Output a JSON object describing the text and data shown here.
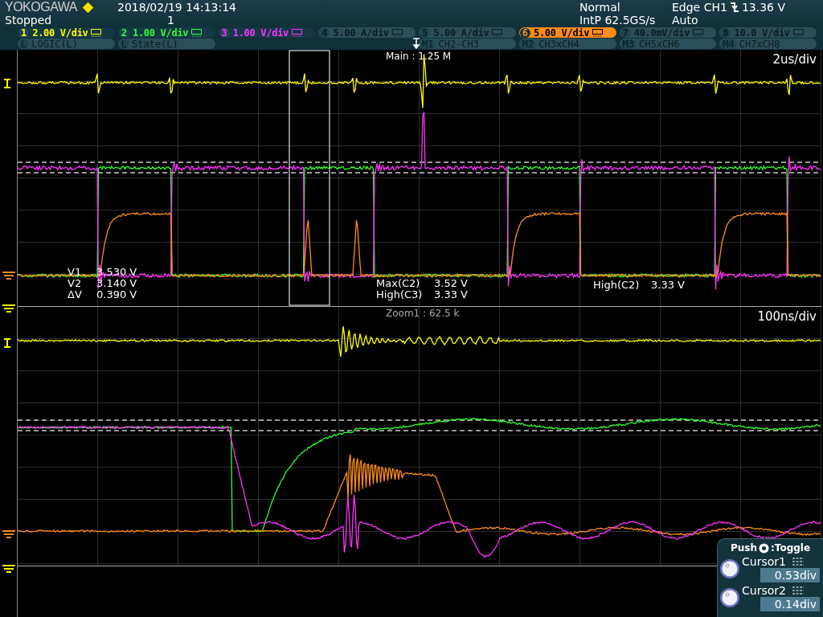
{
  "header": {
    "brand": "YOKOGAWA",
    "datetime": "2018/02/19 14:13:14",
    "state": "Stopped",
    "acq_count": "1",
    "mode": "Normal",
    "sample_rate": "IntP 62.5GS/s",
    "trigger_type": "Edge CH1",
    "trigger_level": "13.36 V",
    "trigger_mode": "Auto"
  },
  "channels": [
    {
      "number": "1",
      "scale": "2.00 V/div",
      "color": "#ffff00",
      "enabled": true,
      "selected": false
    },
    {
      "number": "2",
      "scale": "1.00 V/div",
      "color": "#33ff33",
      "enabled": true,
      "selected": false
    },
    {
      "number": "3",
      "scale": "1.00 V/div",
      "color": "#ff33ff",
      "enabled": true,
      "selected": false
    },
    {
      "number": "4",
      "scale": "5.00 A/div",
      "enabled": false,
      "selected": false
    },
    {
      "number": "5",
      "scale": "5.00 A/div",
      "enabled": false,
      "selected": false
    },
    {
      "number": "6",
      "scale": "5.00 V/div",
      "color": "#ff8c1a",
      "enabled": true,
      "selected": true
    },
    {
      "number": "7",
      "scale": "40.0mV/div",
      "enabled": false,
      "selected": false
    },
    {
      "number": "8",
      "scale": "10.0 V/div",
      "enabled": false,
      "selected": false
    }
  ],
  "logic": [
    {
      "badge": "L",
      "name": "LOGIC(L)"
    },
    {
      "badge": "L",
      "name": "State(L)"
    }
  ],
  "math": [
    {
      "badge": "M1",
      "name": "CH2-CH3"
    },
    {
      "badge": "M2",
      "name": "CH3xCH4"
    },
    {
      "badge": "M3",
      "name": "CH5xCH6"
    },
    {
      "badge": "M4",
      "name": "CH7xCH8"
    }
  ],
  "main": {
    "title": "Main : 1.25 M",
    "timebase": "2us/div",
    "cursors": [
      {
        "label": "V1",
        "value": "3.530 V"
      },
      {
        "label": "V2",
        "value": "3.140 V"
      },
      {
        "label": "ΔV",
        "value": "0.390 V"
      }
    ],
    "measurements": [
      {
        "label": "Max(C2)",
        "value": "3.52 V"
      },
      {
        "label": "High(C3)",
        "value": "3.33 V"
      },
      {
        "label": "High(C2)",
        "value": "3.33 V"
      }
    ]
  },
  "zoom": {
    "title": "Zoom1 : 62.5 k",
    "timebase": "100ns/div"
  },
  "cursor_panel": {
    "hint_prefix": "Push",
    "hint_suffix": ":Toggle",
    "knobs": [
      {
        "label": "Cursor1",
        "value": "0.53div"
      },
      {
        "label": "Cursor2",
        "value": "0.14div"
      }
    ]
  }
}
